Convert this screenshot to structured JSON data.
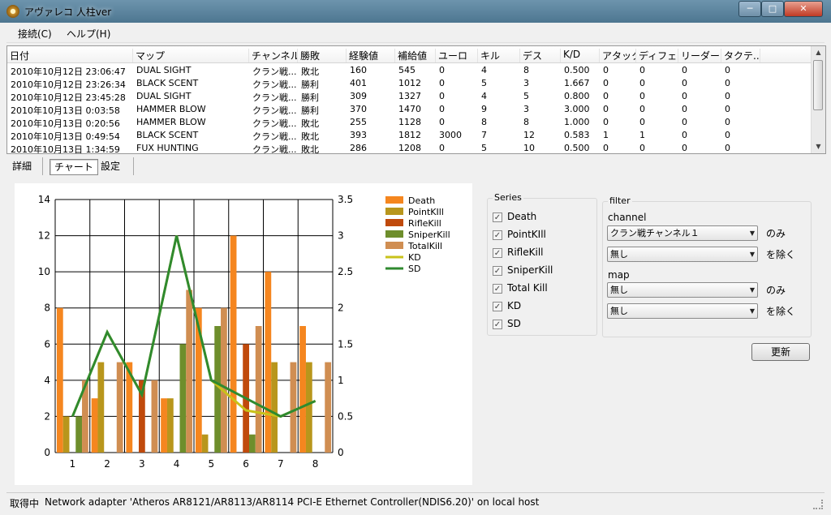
{
  "window": {
    "title": "アヴァレコ 人柱ver",
    "min": "─",
    "max": "□",
    "close": "✕"
  },
  "menu": [
    {
      "label": "接続(C)"
    },
    {
      "label": "ヘルプ(H)"
    }
  ],
  "table": {
    "columns": [
      "日付",
      "マップ",
      "チャンネル",
      "勝敗",
      "経験値",
      "補給値",
      "ユーロ",
      "キル",
      "デス",
      "K/D",
      "アタック",
      "ディフェ...",
      "リーダー",
      "タクテ..."
    ],
    "rows": [
      [
        "2010年10月12日  23:06:47",
        "DUAL SIGHT",
        "クラン戦...",
        "敗北",
        "160",
        "545",
        "0",
        "4",
        "8",
        "0.500",
        "0",
        "0",
        "0",
        "0"
      ],
      [
        "2010年10月12日  23:26:34",
        "BLACK SCENT",
        "クラン戦...",
        "勝利",
        "401",
        "1012",
        "0",
        "5",
        "3",
        "1.667",
        "0",
        "0",
        "0",
        "0"
      ],
      [
        "2010年10月12日  23:45:28",
        "DUAL SIGHT",
        "クラン戦...",
        "勝利",
        "309",
        "1327",
        "0",
        "4",
        "5",
        "0.800",
        "0",
        "0",
        "0",
        "0"
      ],
      [
        "2010年10月13日  0:03:58",
        "HAMMER BLOW",
        "クラン戦...",
        "勝利",
        "370",
        "1470",
        "0",
        "9",
        "3",
        "3.000",
        "0",
        "0",
        "0",
        "0"
      ],
      [
        "2010年10月13日  0:20:56",
        "HAMMER BLOW",
        "クラン戦...",
        "敗北",
        "255",
        "1128",
        "0",
        "8",
        "8",
        "1.000",
        "0",
        "0",
        "0",
        "0"
      ],
      [
        "2010年10月13日  0:49:54",
        "BLACK SCENT",
        "クラン戦...",
        "敗北",
        "393",
        "1812",
        "3000",
        "7",
        "12",
        "0.583",
        "1",
        "1",
        "0",
        "0"
      ],
      [
        "2010年10月13日  1:34:59",
        "FUX HUNTING",
        "クラン戦...",
        "敗北",
        "286",
        "1208",
        "0",
        "5",
        "10",
        "0.500",
        "0",
        "0",
        "0",
        "0"
      ]
    ]
  },
  "tabs": [
    {
      "label": "詳細"
    },
    {
      "label": "チャート"
    },
    {
      "label": "設定"
    }
  ],
  "selected_tab": 1,
  "chart_data": {
    "type": "bar",
    "categories": [
      "1",
      "2",
      "3",
      "4",
      "5",
      "6",
      "7",
      "8"
    ],
    "y_left": {
      "min": 0,
      "max": 14,
      "ticks": [
        "0",
        "2",
        "4",
        "6",
        "8",
        "10",
        "12",
        "14"
      ]
    },
    "y_right": {
      "min": 0,
      "max": 3.5,
      "ticks": [
        "0",
        "0.5",
        "1",
        "1.5",
        "2",
        "2.5",
        "3",
        "3.5"
      ]
    },
    "grid": true,
    "legend_position": "right",
    "series": [
      {
        "name": "Death",
        "kind": "bar",
        "color": "#f5861f",
        "values": [
          8,
          3,
          5,
          3,
          8,
          12,
          10,
          7
        ]
      },
      {
        "name": "PointKIll",
        "kind": "bar",
        "color": "#b8961c",
        "values": [
          2,
          5,
          0,
          3,
          1,
          0,
          5,
          5
        ]
      },
      {
        "name": "RifleKill",
        "kind": "bar",
        "color": "#c04a0c",
        "values": [
          0,
          0,
          4,
          0,
          0,
          6,
          0,
          0
        ]
      },
      {
        "name": "SniperKill",
        "kind": "bar",
        "color": "#6e8e2c",
        "values": [
          2,
          0,
          0,
          6,
          7,
          1,
          0,
          0
        ]
      },
      {
        "name": "TotalKill",
        "kind": "bar",
        "color": "#d08e52",
        "values": [
          4,
          5,
          4,
          9,
          8,
          7,
          5,
          5
        ]
      },
      {
        "name": "KD",
        "kind": "line",
        "axis": "right",
        "color": "#c8c21a",
        "values": [
          0.5,
          1.667,
          0.8,
          3.0,
          1.0,
          0.583,
          0.5,
          0.714
        ]
      },
      {
        "name": "SD",
        "kind": "line",
        "axis": "right",
        "color": "#2f8a2f",
        "values": [
          0.5,
          1.667,
          0.8,
          3.0,
          1.0,
          0.75,
          0.5,
          0.714
        ]
      }
    ]
  },
  "series_panel": {
    "title": "Series",
    "items": [
      {
        "label": "Death",
        "checked": true
      },
      {
        "label": "PointKIll",
        "checked": true
      },
      {
        "label": "RifleKill",
        "checked": true
      },
      {
        "label": "SniperKill",
        "checked": true
      },
      {
        "label": "Total Kill",
        "checked": true
      },
      {
        "label": "KD",
        "checked": true
      },
      {
        "label": "SD",
        "checked": true
      }
    ],
    "check_glyph": "✓"
  },
  "filter": {
    "title": "filter",
    "channel_label": "channel",
    "channel_value": "クラン戦チャンネル１",
    "channel_only": "のみ",
    "channel_exclude_value": "無し",
    "channel_exclude": "を除く",
    "map_label": "map",
    "map_value": "無し",
    "map_only": "のみ",
    "map_exclude_value": "無し",
    "map_exclude": "を除く",
    "combo_arrow": "▼"
  },
  "update_button": "更新",
  "status": {
    "state": "取得中",
    "message": "Network adapter 'Atheros AR8121/AR8113/AR8114 PCI-E Ethernet Controller(NDIS6.20)' on local host"
  },
  "scroll": {
    "up": "▲",
    "down": "▼"
  }
}
